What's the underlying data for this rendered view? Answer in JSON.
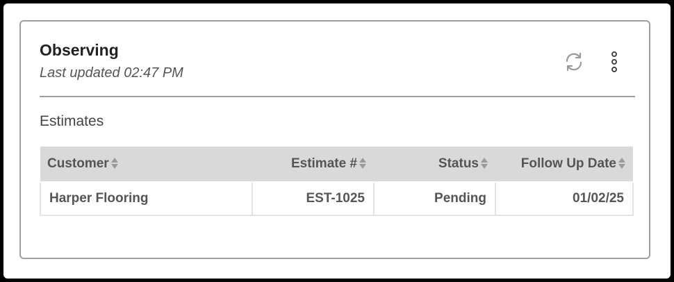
{
  "card": {
    "title": "Observing",
    "subtitle": "Last updated 02:47 PM",
    "refresh_icon": "refresh-icon",
    "more_icon": "more-vertical-icon"
  },
  "section": {
    "title": "Estimates"
  },
  "table": {
    "columns": [
      "Customer",
      "Estimate #",
      "Status",
      "Follow Up Date"
    ],
    "sort_icon": "sort-icon",
    "rows": [
      [
        "Harper Flooring",
        "EST-1025",
        "Pending",
        "01/02/25"
      ]
    ]
  },
  "colors": {
    "card_border": "#9e9e9e",
    "header_bg": "#d9d9d9",
    "text": "#555555"
  }
}
